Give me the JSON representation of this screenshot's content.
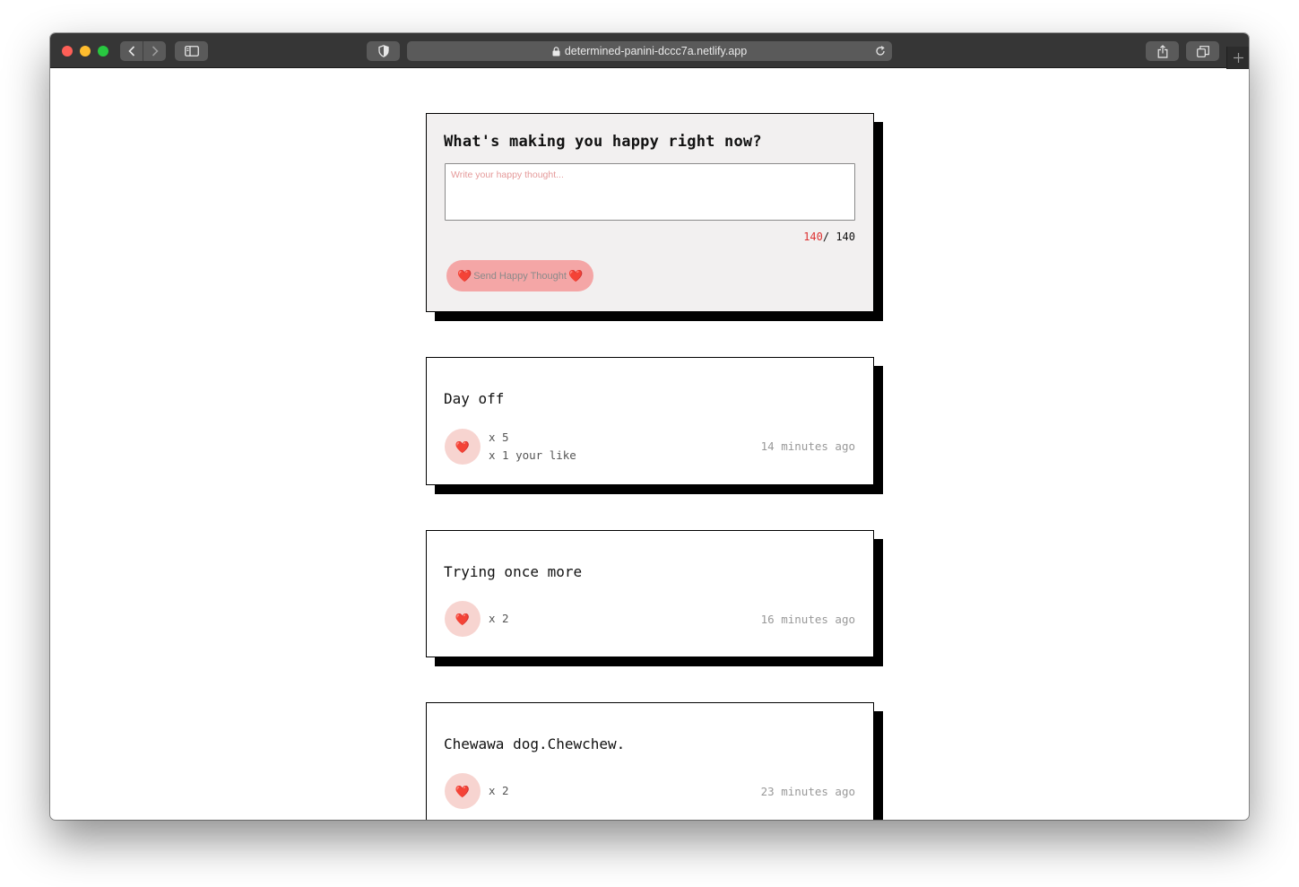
{
  "browser": {
    "url": "determined-panini-dccc7a.netlify.app"
  },
  "form": {
    "title": "What's making you happy right now?",
    "placeholder": "Write your happy thought...",
    "counter_remaining": "140",
    "counter_total": "/ 140",
    "send_label": "Send Happy Thought",
    "heart_glyph": "❤️"
  },
  "thoughts": [
    {
      "text": "Day off",
      "likes": "x 5",
      "your_like": "x 1 your like",
      "time": "14 minutes ago"
    },
    {
      "text": "Trying once more",
      "likes": "x 2",
      "time": "16 minutes ago"
    },
    {
      "text": "Chewawa dog.Chewchew.",
      "likes": "x 2",
      "time": "23 minutes ago"
    }
  ],
  "colors": {
    "accent_pink": "#f4a6a6",
    "like_bg": "#f7d4d0",
    "heart_red": "#e0213d",
    "form_bg": "#f2f0f0"
  }
}
